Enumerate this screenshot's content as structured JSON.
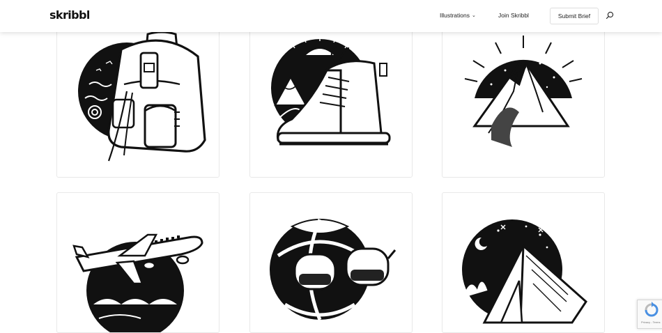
{
  "header": {
    "logo": "skribbl",
    "nav": {
      "illustrations_label": "Illustrations",
      "join_label": "Join Skribbl",
      "submit_label": "Submit Brief"
    },
    "icons": {
      "dropdown": "chevron-down-icon",
      "search": "search-icon"
    }
  },
  "gallery": {
    "items": [
      {
        "subject": "backpack"
      },
      {
        "subject": "hiking-boot"
      },
      {
        "subject": "mountain"
      },
      {
        "subject": "airplane"
      },
      {
        "subject": "beach-ball-sunglasses"
      },
      {
        "subject": "tent"
      }
    ]
  },
  "recaptcha": {
    "terms": "Privacy - Terms"
  },
  "colors": {
    "ink": "#111111",
    "background": "#ffffff",
    "card_border": "#e8e8e8"
  }
}
